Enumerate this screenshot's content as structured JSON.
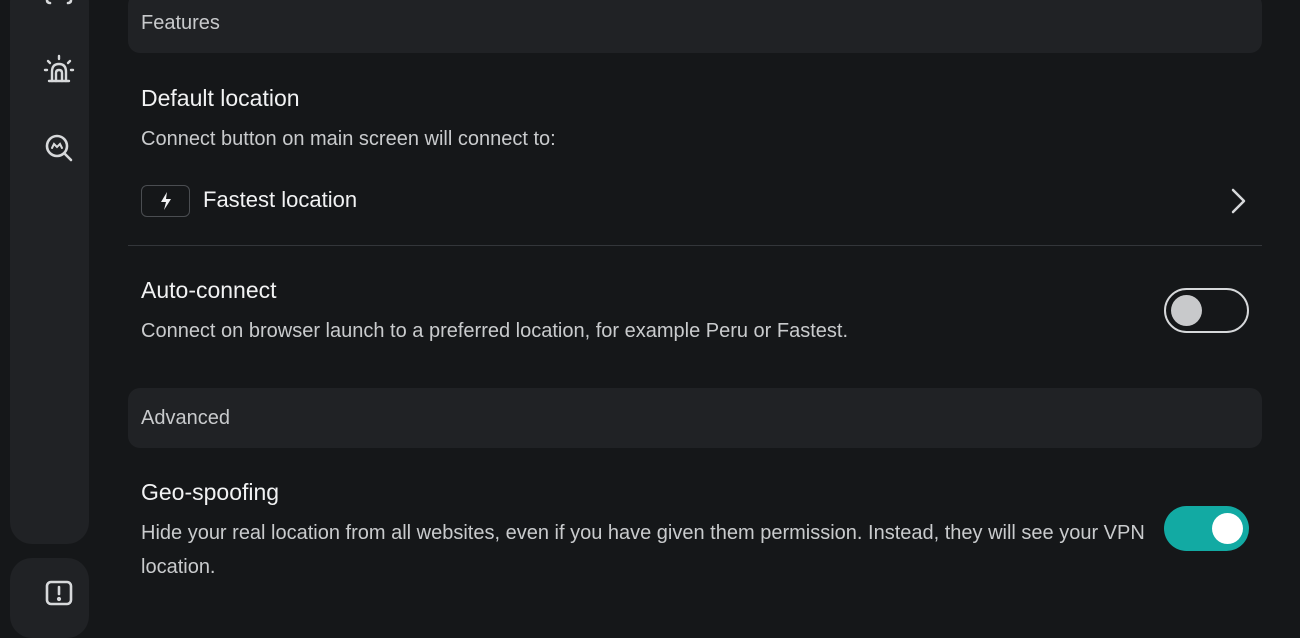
{
  "sidebar": {
    "icons": [
      "braces-icon",
      "alarm-icon",
      "search-icon",
      "feedback-icon"
    ]
  },
  "sections": {
    "features_label": "Features",
    "advanced_label": "Advanced"
  },
  "default_location": {
    "title": "Default location",
    "description": "Connect button on main screen will connect to:",
    "value": "Fastest location",
    "icon": "bolt-icon"
  },
  "auto_connect": {
    "title": "Auto-connect",
    "description": "Connect on browser launch to a preferred location, for example Peru or Fastest.",
    "enabled": false
  },
  "geo_spoofing": {
    "title": "Geo-spoofing",
    "description": "Hide your real location from all websites, even if you have given them permission. Instead, they will see your VPN location.",
    "enabled": true
  },
  "colors": {
    "accent": "#12aaa3",
    "background": "#151719",
    "panel": "#202225"
  }
}
